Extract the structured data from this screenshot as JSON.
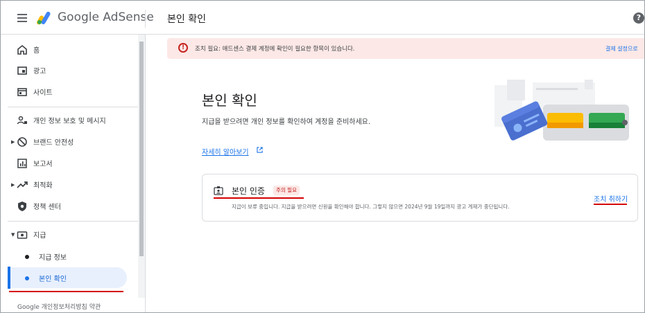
{
  "header": {
    "app_name": "Google AdSense",
    "page_title": "본인 확인"
  },
  "sidebar": {
    "items": [
      {
        "label": "홈",
        "icon": "home-icon"
      },
      {
        "label": "광고",
        "icon": "ads-icon"
      },
      {
        "label": "사이트",
        "icon": "sites-icon"
      },
      {
        "label": "개인 정보 보호 및 메시지",
        "icon": "privacy-icon"
      },
      {
        "label": "브랜드 안전성",
        "icon": "block-icon"
      },
      {
        "label": "보고서",
        "icon": "reports-icon"
      },
      {
        "label": "최적화",
        "icon": "trend-icon"
      },
      {
        "label": "정책 센터",
        "icon": "shield-icon"
      },
      {
        "label": "지급",
        "icon": "payments-icon"
      }
    ],
    "sub_items": [
      {
        "label": "지급 정보"
      },
      {
        "label": "본인 확인"
      }
    ],
    "footer": "Google  개인정보처리방침  약관"
  },
  "banner": {
    "text": "조치 필요: 애드센스 결제 계정에 확인이 필요한 항목이 있습니다.",
    "action": "결제 설정으로"
  },
  "main": {
    "title": "본인 확인",
    "description": "지급을 받으려면 개인 정보를 확인하여 계정을 준비하세요.",
    "learn_more": "자세히 알아보기"
  },
  "card": {
    "title": "본인 인증",
    "badge": "주의 필요",
    "subtitle": "지급이 보류 중입니다. 지급을 받으려면 신원을 확인해야 합니다. 그렇지 않으면 2024년 9월 19일까지 광고 게재가 중단됩니다.",
    "action": "조치 취하기"
  },
  "colors": {
    "accent": "#1a73e8",
    "alert": "#c5221f",
    "alert_bg": "#fce8e6",
    "annotation": "#d50000"
  }
}
